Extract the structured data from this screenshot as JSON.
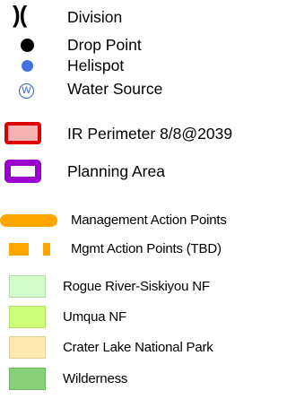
{
  "legend": {
    "items": [
      {
        "label": "Division",
        "symbol": "division-marker",
        "glyph": ")("
      },
      {
        "label": "Drop Point",
        "symbol": "black-dot",
        "color": "#000000"
      },
      {
        "label": "Helispot",
        "symbol": "blue-dot",
        "color": "#4472dc"
      },
      {
        "label": "Water Source",
        "symbol": "water-circle",
        "glyph": "W",
        "color": "#3a5fd0"
      },
      {
        "label": "IR Perimeter 8/8@2039",
        "symbol": "red-outlined-box",
        "fill": "#f5b3b3",
        "stroke": "#dd0000"
      },
      {
        "label": "Planning Area",
        "symbol": "purple-outlined-box",
        "fill": "#ffffff",
        "stroke": "#9b00d0"
      },
      {
        "label": "Management Action Points",
        "symbol": "orange-line",
        "color": "#ffa500"
      },
      {
        "label": "Mgmt Action Points (TBD)",
        "symbol": "orange-dashed-line",
        "color": "#ffa500"
      },
      {
        "label": "Rogue River-Siskiyou NF",
        "symbol": "swatch",
        "fill": "#d4fbcb"
      },
      {
        "label": "Umqua NF",
        "symbol": "swatch",
        "fill": "#ceff78"
      },
      {
        "label": "Crater Lake National Park",
        "symbol": "swatch",
        "fill": "#ffe9b3"
      },
      {
        "label": "Wilderness",
        "symbol": "swatch",
        "fill": "#88d07a"
      }
    ]
  }
}
